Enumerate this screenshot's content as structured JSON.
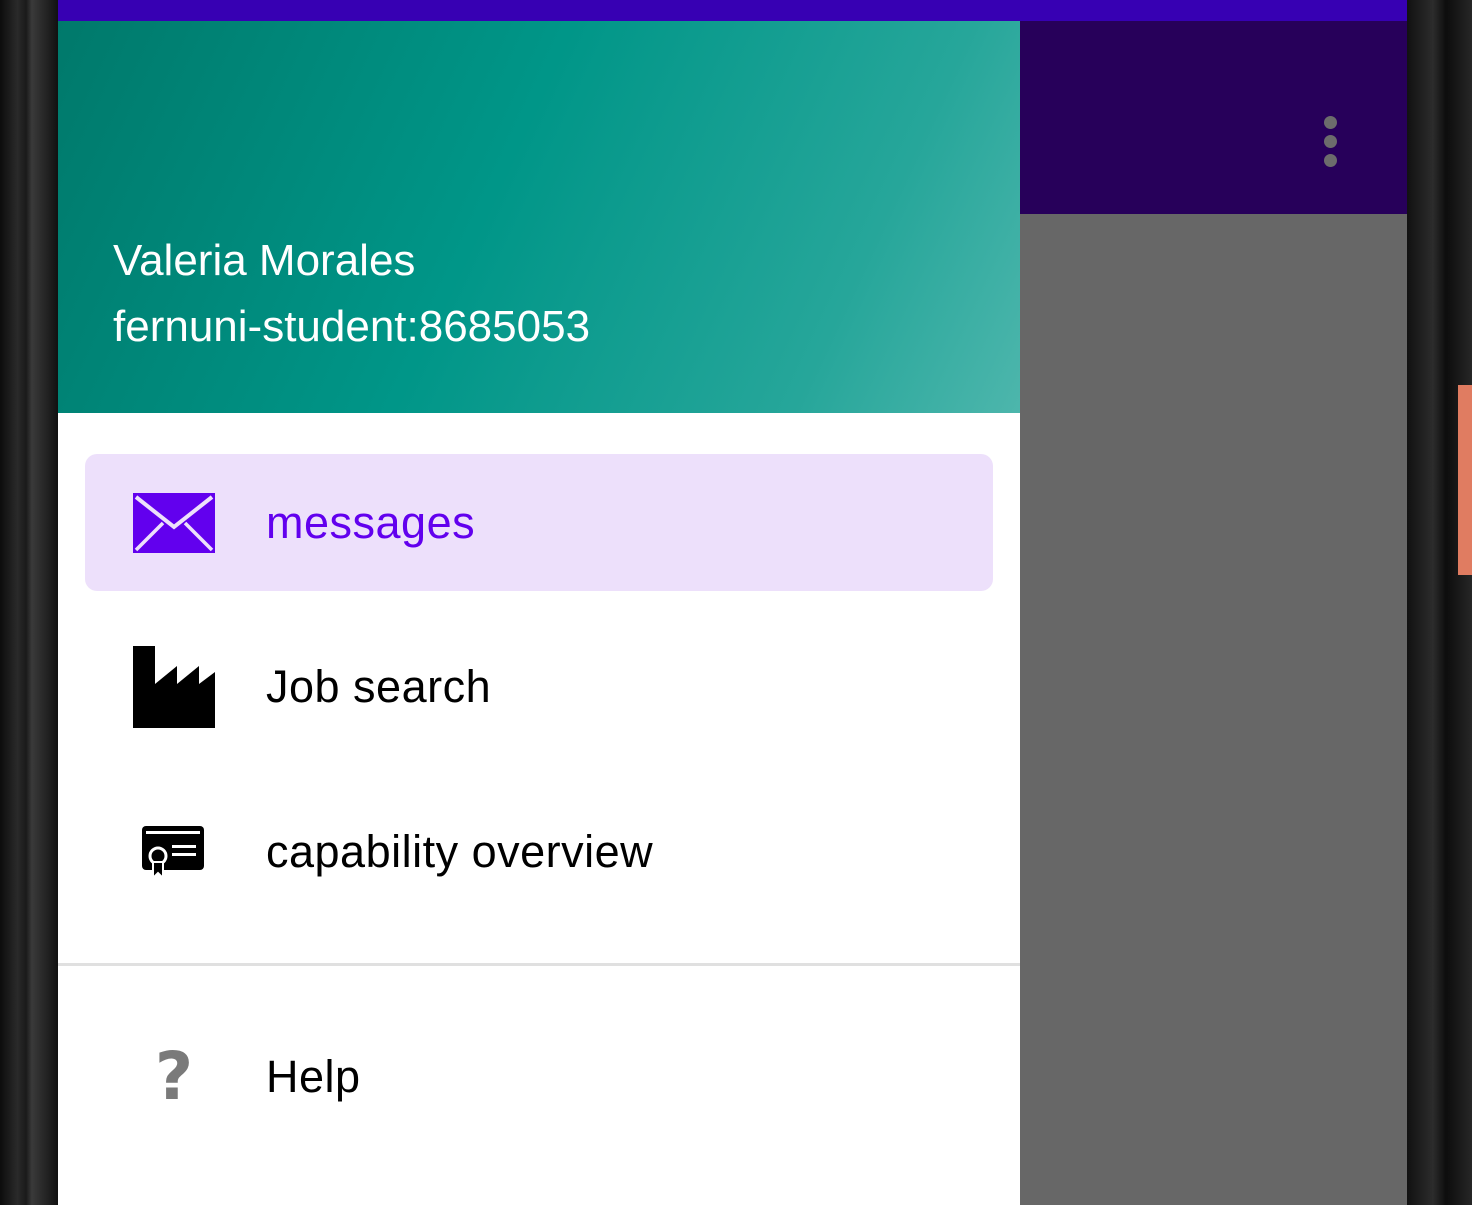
{
  "colors": {
    "status_bar": "#3700b3",
    "app_bar": "#27005a",
    "scrim": "#676767",
    "accent": "#6200ee",
    "active_item_bg": "#ede0fb",
    "header_gradient": [
      "#00796b",
      "#009688",
      "#4db6ac"
    ]
  },
  "app_bar": {
    "overflow_icon": "more-vert-icon"
  },
  "drawer": {
    "header": {
      "name": "Valeria Morales",
      "account": "fernuni-student:8685053"
    },
    "items": [
      {
        "label": "messages",
        "icon": "envelope-icon",
        "active": true
      },
      {
        "label": "Job search",
        "icon": "factory-icon",
        "active": false
      },
      {
        "label": "capability overview",
        "icon": "certificate-icon",
        "active": false
      }
    ],
    "secondary_items": [
      {
        "label": "Help",
        "icon": "help-icon"
      }
    ]
  }
}
